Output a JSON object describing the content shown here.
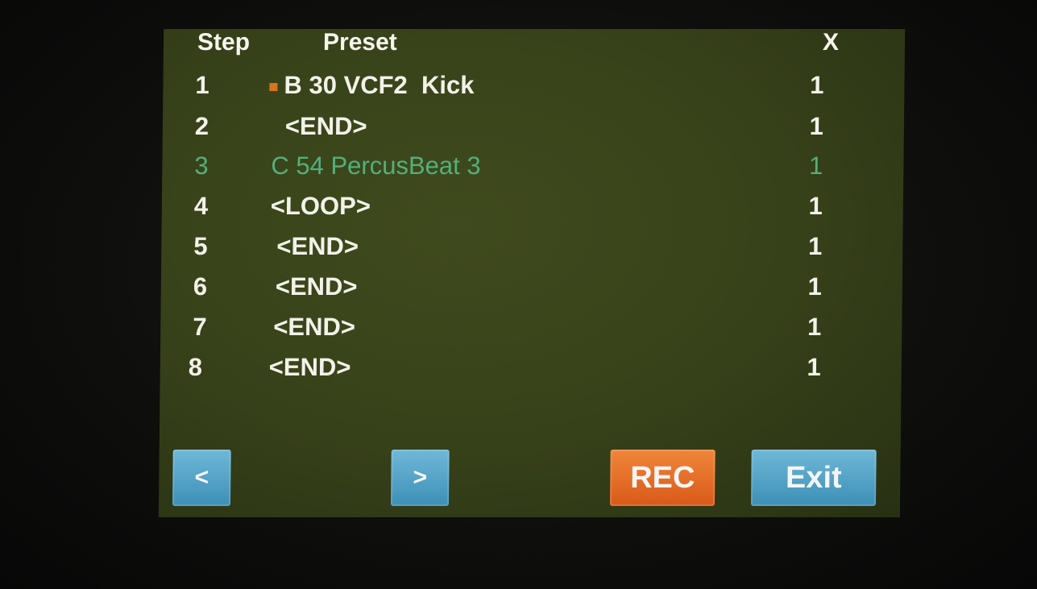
{
  "header": {
    "step_label": "Step",
    "preset_label": "Preset",
    "x_label": "X"
  },
  "rows": [
    {
      "step": "1",
      "preset": "B 30 VCF2  Kick",
      "x": "1"
    },
    {
      "step": "2",
      "preset": "<END>",
      "x": "1"
    },
    {
      "step": "3",
      "preset": "C 54 PercusBeat 3",
      "x": "1"
    },
    {
      "step": "4",
      "preset": "<LOOP>",
      "x": "1"
    },
    {
      "step": "5",
      "preset": "<END>",
      "x": "1"
    },
    {
      "step": "6",
      "preset": "<END>",
      "x": "1"
    },
    {
      "step": "7",
      "preset": "<END>",
      "x": "1"
    },
    {
      "step": "8",
      "preset": "<END>",
      "x": "1"
    }
  ],
  "buttons": {
    "prev": "<",
    "next": ">",
    "rec": "REC",
    "exit": "Exit"
  },
  "colors": {
    "screen_bg": "#3a441b",
    "text": "#f2f2ea",
    "selected_text": "#53b07a",
    "marker": "#d8741e",
    "button_blue": "#4f9fc4",
    "button_orange": "#e6692a"
  }
}
